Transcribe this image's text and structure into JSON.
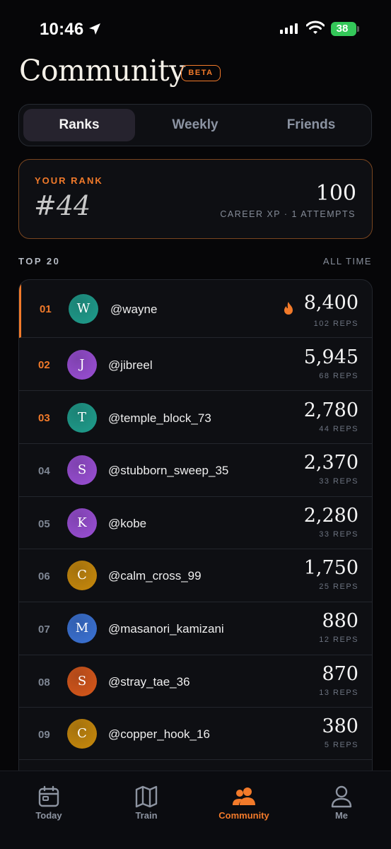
{
  "status_bar": {
    "time": "10:46",
    "battery": "38"
  },
  "header": {
    "title": "Community",
    "badge": "BETA"
  },
  "tabs": [
    {
      "label": "Ranks",
      "active": true
    },
    {
      "label": "Weekly",
      "active": false
    },
    {
      "label": "Friends",
      "active": false
    }
  ],
  "your_rank": {
    "label": "YOUR RANK",
    "rank": "#44",
    "xp": "100",
    "subtitle": "CAREER XP · 1 ATTEMPTS"
  },
  "leaderboard": {
    "title": "TOP 20",
    "filter": "ALL TIME",
    "rows": [
      {
        "rank": "01",
        "initial": "W",
        "handle": "@wayne",
        "score": "8,400",
        "reps": "102 REPS",
        "avatar_color": "#1f9e8d",
        "streak_icon": "flame-icon"
      },
      {
        "rank": "02",
        "initial": "J",
        "handle": "@jibreel",
        "score": "5,945",
        "reps": "68 REPS",
        "avatar_color": "#9b4fd6"
      },
      {
        "rank": "03",
        "initial": "T",
        "handle": "@temple_block_73",
        "score": "2,780",
        "reps": "44 REPS",
        "avatar_color": "#1f9e8d"
      },
      {
        "rank": "04",
        "initial": "S",
        "handle": "@stubborn_sweep_35",
        "score": "2,370",
        "reps": "33 REPS",
        "avatar_color": "#9b4fd6"
      },
      {
        "rank": "05",
        "initial": "K",
        "handle": "@kobe",
        "score": "2,280",
        "reps": "33 REPS",
        "avatar_color": "#9b4fd6"
      },
      {
        "rank": "06",
        "initial": "C",
        "handle": "@calm_cross_99",
        "score": "1,750",
        "reps": "25 REPS",
        "avatar_color": "#c98a0c"
      },
      {
        "rank": "07",
        "initial": "M",
        "handle": "@masanori_kamizani",
        "score": "880",
        "reps": "12 REPS",
        "avatar_color": "#3b73d6"
      },
      {
        "rank": "08",
        "initial": "S",
        "handle": "@stray_tae_36",
        "score": "870",
        "reps": "13 REPS",
        "avatar_color": "#d9581b"
      },
      {
        "rank": "09",
        "initial": "C",
        "handle": "@copper_hook_16",
        "score": "380",
        "reps": "5 REPS",
        "avatar_color": "#c98a0c"
      }
    ]
  },
  "nav": [
    {
      "label": "Today",
      "icon": "calendar-icon"
    },
    {
      "label": "Train",
      "icon": "map-icon"
    },
    {
      "label": "Community",
      "icon": "community-icon",
      "active": true
    },
    {
      "label": "Me",
      "icon": "person-icon"
    }
  ],
  "colors": {
    "accent": "#f27a2a",
    "background": "#060608",
    "card": "#0e0f13"
  }
}
